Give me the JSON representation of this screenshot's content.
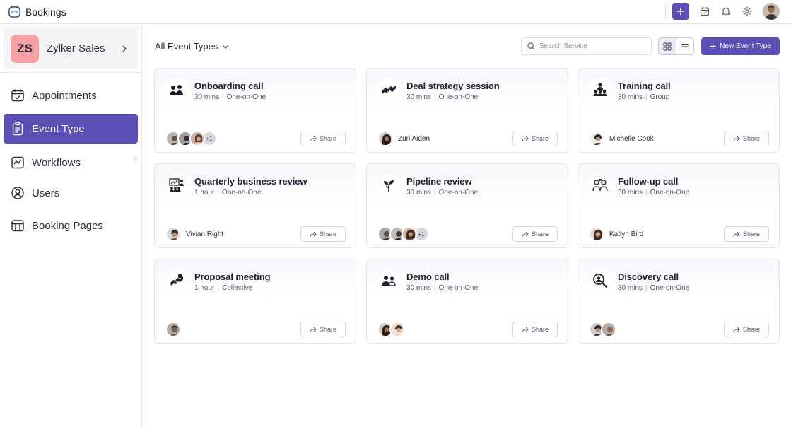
{
  "app": {
    "title": "Bookings"
  },
  "org": {
    "initials": "ZS",
    "name": "Zylker Sales",
    "badge_color": "#f7a1a4"
  },
  "nav": [
    {
      "label": "Appointments",
      "icon": "calendar-check-icon",
      "active": false
    },
    {
      "label": "Event Type",
      "icon": "clipboard-icon",
      "active": true
    },
    {
      "label": "Workflows",
      "icon": "workflow-icon",
      "active": false
    },
    {
      "label": "Users",
      "icon": "user-circle-icon",
      "active": false
    },
    {
      "label": "Booking Pages",
      "icon": "booking-pages-icon",
      "active": false
    }
  ],
  "toolbar": {
    "event_type_filter": "All Event Types",
    "search_placeholder": "Search Service",
    "new_button": "New Event Type"
  },
  "colors": {
    "accent": "#5a4fb5",
    "active_nav": "#5a4fb5"
  },
  "cards": [
    {
      "title": "Onboarding call",
      "duration": "30 mins",
      "kind": "One-on-One",
      "icon": "onboarding-icon",
      "host": "",
      "avatars": 3,
      "extra": "+1",
      "share": "Share"
    },
    {
      "title": "Deal strategy session",
      "duration": "30 mins",
      "kind": "One-on-One",
      "icon": "handshake-icon",
      "host": "Zuri Aiden",
      "avatars": 1,
      "extra": "",
      "share": "Share"
    },
    {
      "title": "Training call",
      "duration": "30 mins",
      "kind": "Group",
      "icon": "group-training-icon",
      "host": "Michelle Cook",
      "avatars": 1,
      "extra": "",
      "share": "Share"
    },
    {
      "title": "Quarterly business review",
      "duration": "1 hour",
      "kind": "One-on-One",
      "icon": "presentation-icon",
      "host": "Vivian Right",
      "avatars": 1,
      "extra": "",
      "share": "Share"
    },
    {
      "title": "Pipeline review",
      "duration": "30 mins",
      "kind": "One-on-One",
      "icon": "growth-plant-icon",
      "host": "",
      "avatars": 3,
      "extra": "+1",
      "share": "Share"
    },
    {
      "title": "Follow-up call",
      "duration": "30 mins",
      "kind": "One-on-One",
      "icon": "chat-users-icon",
      "host": "Katlyn Bird",
      "avatars": 1,
      "extra": "",
      "share": "Share"
    },
    {
      "title": "Proposal meeting",
      "duration": "1 hour",
      "kind": "Collective",
      "icon": "deal-icon",
      "host": "",
      "avatars": 1,
      "extra": "",
      "share": "Share"
    },
    {
      "title": "Demo call",
      "duration": "30 mins",
      "kind": "One-on-One",
      "icon": "demo-users-icon",
      "host": "",
      "avatars": 2,
      "extra": "",
      "share": "Share"
    },
    {
      "title": "Discovery call",
      "duration": "30 mins",
      "kind": "One-on-One",
      "icon": "discovery-search-icon",
      "host": "",
      "avatars": 2,
      "extra": "",
      "share": "Share"
    }
  ]
}
